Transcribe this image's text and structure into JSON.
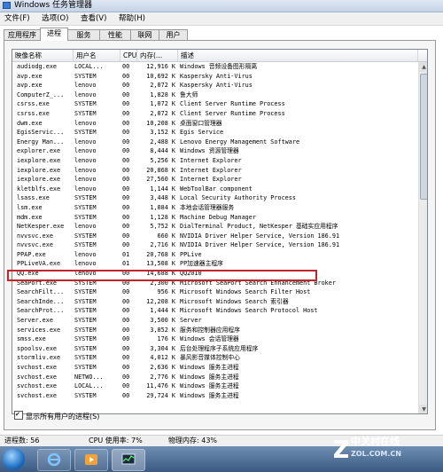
{
  "window": {
    "title": "Windows 任务管理器"
  },
  "menu": [
    "文件(F)",
    "选项(O)",
    "查看(V)",
    "帮助(H)"
  ],
  "tabs": [
    {
      "label": "应用程序",
      "active": false
    },
    {
      "label": "进程",
      "active": true
    },
    {
      "label": "服务",
      "active": false
    },
    {
      "label": "性能",
      "active": false
    },
    {
      "label": "联网",
      "active": false
    },
    {
      "label": "用户",
      "active": false
    }
  ],
  "columns": {
    "name": "映像名称",
    "user": "用户名",
    "cpu": "CPU",
    "mem": "内存(...",
    "desc": "描述"
  },
  "processes": [
    {
      "name": "audiodg.exe",
      "user": "LOCAL...",
      "cpu": "00",
      "mem": "12,916 K",
      "desc": "Windows 音频设备图形隔离"
    },
    {
      "name": "avp.exe",
      "user": "SYSTEM",
      "cpu": "00",
      "mem": "10,692 K",
      "desc": "Kaspersky Anti-Virus"
    },
    {
      "name": "avp.exe",
      "user": "lenovo",
      "cpu": "00",
      "mem": "2,072 K",
      "desc": "Kaspersky Anti-Virus"
    },
    {
      "name": "ComputerZ_...",
      "user": "lenovo",
      "cpu": "00",
      "mem": "1,828 K",
      "desc": "鲁大师"
    },
    {
      "name": "csrss.exe",
      "user": "SYSTEM",
      "cpu": "00",
      "mem": "1,072 K",
      "desc": "Client Server Runtime Process"
    },
    {
      "name": "csrss.exe",
      "user": "SYSTEM",
      "cpu": "00",
      "mem": "2,072 K",
      "desc": "Client Server Runtime Process"
    },
    {
      "name": "dwm.exe",
      "user": "lenovo",
      "cpu": "00",
      "mem": "10,208 K",
      "desc": "桌面窗口管理器"
    },
    {
      "name": "EgisServic...",
      "user": "SYSTEM",
      "cpu": "00",
      "mem": "3,152 K",
      "desc": "Egis Service"
    },
    {
      "name": "Energy Man...",
      "user": "lenovo",
      "cpu": "00",
      "mem": "2,488 K",
      "desc": "Lenovo Energy Management Software"
    },
    {
      "name": "explorer.exe",
      "user": "lenovo",
      "cpu": "00",
      "mem": "8,444 K",
      "desc": "Windows 资源管理器"
    },
    {
      "name": "iexplore.exe",
      "user": "lenovo",
      "cpu": "00",
      "mem": "5,256 K",
      "desc": "Internet Explorer"
    },
    {
      "name": "iexplore.exe",
      "user": "lenovo",
      "cpu": "00",
      "mem": "20,868 K",
      "desc": "Internet Explorer"
    },
    {
      "name": "iexplore.exe",
      "user": "lenovo",
      "cpu": "00",
      "mem": "27,560 K",
      "desc": "Internet Explorer"
    },
    {
      "name": "kletblfs.exe",
      "user": "lenovo",
      "cpu": "00",
      "mem": "1,144 K",
      "desc": "WebToolBar component"
    },
    {
      "name": "lsass.exe",
      "user": "SYSTEM",
      "cpu": "00",
      "mem": "3,448 K",
      "desc": "Local Security Authority Process"
    },
    {
      "name": "lsm.exe",
      "user": "SYSTEM",
      "cpu": "00",
      "mem": "1,084 K",
      "desc": "本地会话管理器服务"
    },
    {
      "name": "mdm.exe",
      "user": "SYSTEM",
      "cpu": "00",
      "mem": "1,128 K",
      "desc": "Machine Debug Manager"
    },
    {
      "name": "NetKesper.exe",
      "user": "lenovo",
      "cpu": "00",
      "mem": "5,752 K",
      "desc": "DialTerminal Product, NetKesper 基础实应用程序"
    },
    {
      "name": "nvvsvc.exe",
      "user": "SYSTEM",
      "cpu": "00",
      "mem": "660 K",
      "desc": "NVIDIA Driver Helper Service, Version 186.91"
    },
    {
      "name": "nvvsvc.exe",
      "user": "SYSTEM",
      "cpu": "00",
      "mem": "2,716 K",
      "desc": "NVIDIA Driver Helper Service, Version 186.91"
    },
    {
      "name": "PPAP.exe",
      "user": "lenovo",
      "cpu": "01",
      "mem": "20,768 K",
      "desc": "PPLive"
    },
    {
      "name": "PPLiveVA.exe",
      "user": "lenovo",
      "cpu": "01",
      "mem": "13,508 K",
      "desc": "PP加速器主程序"
    },
    {
      "name": "QQ.exe",
      "user": "lenovo",
      "cpu": "00",
      "mem": "14,688 K",
      "desc": "QQ2010"
    },
    {
      "name": "SeaPort.exe",
      "user": "SYSTEM",
      "cpu": "00",
      "mem": "2,300 K",
      "desc": "Microsoft SeaPort Search Enhancement Broker"
    },
    {
      "name": "SearchFilt...",
      "user": "SYSTEM",
      "cpu": "00",
      "mem": "956 K",
      "desc": "Microsoft Windows Search Filter Host"
    },
    {
      "name": "SearchInde...",
      "user": "SYSTEM",
      "cpu": "00",
      "mem": "12,208 K",
      "desc": "Microsoft Windows Search 索引器"
    },
    {
      "name": "SearchProt...",
      "user": "SYSTEM",
      "cpu": "00",
      "mem": "1,444 K",
      "desc": "Microsoft Windows Search Protocol Host"
    },
    {
      "name": "Server.exe",
      "user": "SYSTEM",
      "cpu": "00",
      "mem": "3,500 K",
      "desc": "Server"
    },
    {
      "name": "services.exe",
      "user": "SYSTEM",
      "cpu": "00",
      "mem": "3,852 K",
      "desc": "服务和控制器应用程序"
    },
    {
      "name": "smss.exe",
      "user": "SYSTEM",
      "cpu": "00",
      "mem": "176 K",
      "desc": "Windows 会话管理器"
    },
    {
      "name": "spoolsv.exe",
      "user": "SYSTEM",
      "cpu": "00",
      "mem": "3,304 K",
      "desc": "后台处理程序子系统应用程序"
    },
    {
      "name": "stormliv.exe",
      "user": "SYSTEM",
      "cpu": "00",
      "mem": "4,012 K",
      "desc": "暴风影音媒体控制中心"
    },
    {
      "name": "svchost.exe",
      "user": "SYSTEM",
      "cpu": "00",
      "mem": "2,636 K",
      "desc": "Windows 服务主进程"
    },
    {
      "name": "svchost.exe",
      "user": "NETWO...",
      "cpu": "00",
      "mem": "2,776 K",
      "desc": "Windows 服务主进程"
    },
    {
      "name": "svchost.exe",
      "user": "LOCAL...",
      "cpu": "00",
      "mem": "11,476 K",
      "desc": "Windows 服务主进程"
    },
    {
      "name": "svchost.exe",
      "user": "SYSTEM",
      "cpu": "00",
      "mem": "29,724 K",
      "desc": "Windows 服务主进程"
    }
  ],
  "show_all_label": "显示所有用户的进程(S)",
  "status": {
    "processes": "进程数: 56",
    "cpu": "CPU 使用率: 7%",
    "memory": "物理内存: 43%"
  },
  "watermark": {
    "line1": "中关村在线",
    "line2": "ZOL.COM.CN"
  }
}
